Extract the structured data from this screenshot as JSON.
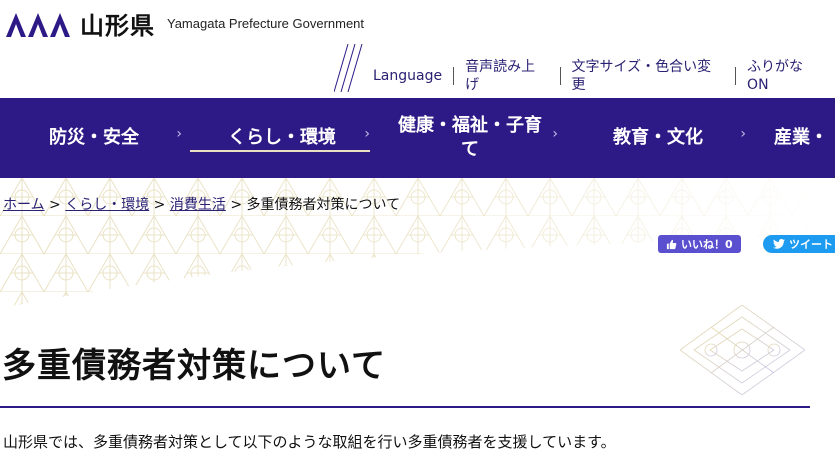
{
  "header": {
    "logo_name": "山形県",
    "logo_en": "Yamagata Prefecture Government",
    "utility_links": [
      {
        "label": "Language"
      },
      {
        "label": "音声読み上げ"
      },
      {
        "label": "文字サイズ・色合い変更"
      },
      {
        "label": "ふりがなON"
      }
    ]
  },
  "nav": {
    "items": [
      {
        "label": "防災・安全",
        "chevron": "›"
      },
      {
        "label": "くらし・環境",
        "chevron": "›"
      },
      {
        "label": "健康・福祉・子育て",
        "chevron": "›"
      },
      {
        "label": "教育・文化",
        "chevron": "›"
      },
      {
        "label": "産業・"
      }
    ]
  },
  "breadcrumb": {
    "home": "ホーム",
    "sep": " > ",
    "level1": "くらし・環境",
    "level2": "消費生活",
    "current": "多重債務者対策について"
  },
  "social": {
    "like_label": "いいね！0",
    "tweet_label": "ツイート"
  },
  "page": {
    "title": "多重債務者対策について",
    "intro": "山形県では、多重債務者対策として以下のような取組を行い多重債務者を支援しています。"
  },
  "colors": {
    "brand": "#2e1a86",
    "link": "#2a2173",
    "like": "#5a4fcf",
    "tweet": "#1d9bf0",
    "pattern": "#e9e1c2"
  }
}
